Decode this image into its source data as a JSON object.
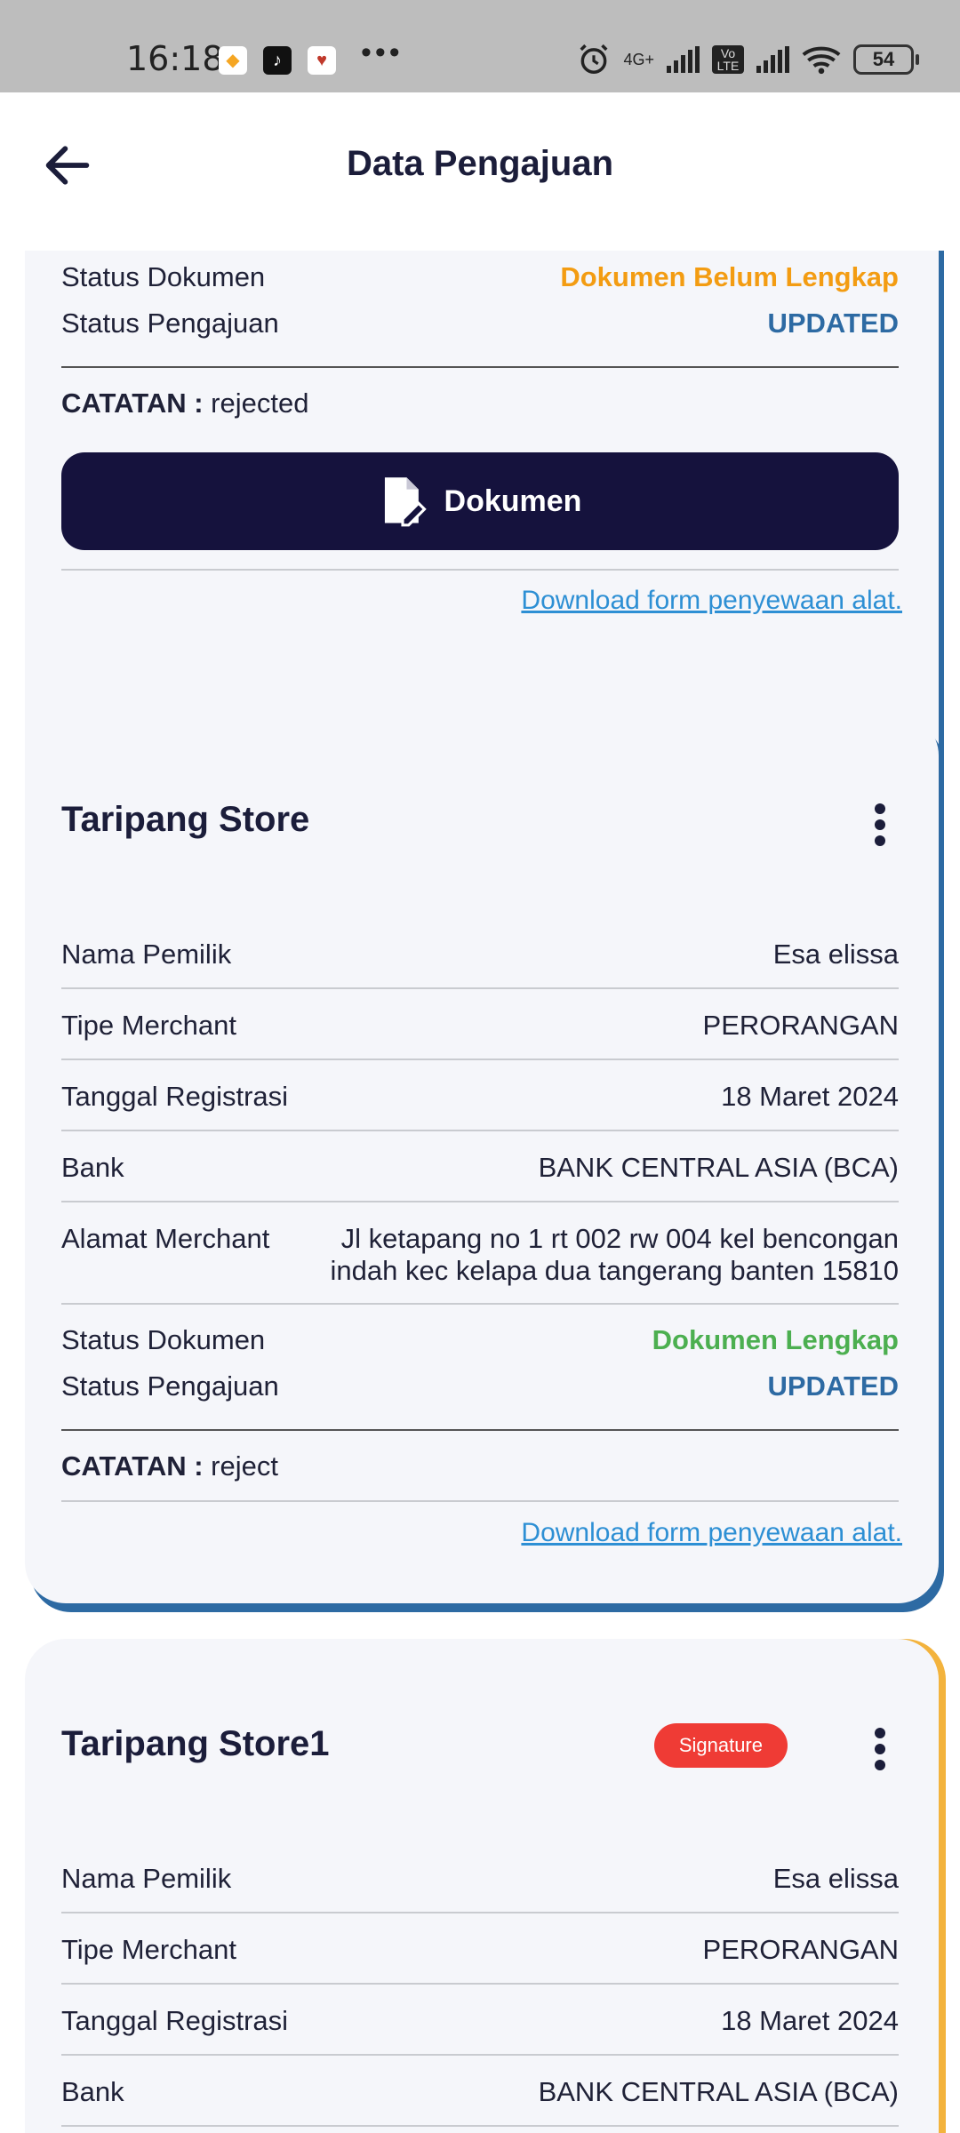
{
  "status_bar": {
    "time": "16:18",
    "network_label": "4G+",
    "volte_label": "Vo LTE",
    "battery": "54"
  },
  "header": {
    "title": "Data Pengajuan"
  },
  "card1": {
    "status_dokumen_label": "Status Dokumen",
    "status_dokumen_value": "Dokumen Belum Lengkap",
    "status_pengajuan_label": "Status Pengajuan",
    "status_pengajuan_value": "UPDATED",
    "catatan_label": "CATATAN :",
    "catatan_value": "rejected",
    "dokumen_button": "Dokumen",
    "download_link": "Download form penyewaan alat."
  },
  "card2": {
    "title": "Taripang Store",
    "nama_pemilik_label": "Nama Pemilik",
    "nama_pemilik_value": "Esa elissa",
    "tipe_merchant_label": "Tipe Merchant",
    "tipe_merchant_value": "PERORANGAN",
    "tanggal_label": "Tanggal Registrasi",
    "tanggal_value": "18 Maret 2024",
    "bank_label": "Bank",
    "bank_value": "BANK CENTRAL ASIA (BCA)",
    "alamat_label": "Alamat Merchant",
    "alamat_line1": "Jl ketapang no 1 rt 002 rw 004 kel bencongan",
    "alamat_line2": "indah kec kelapa dua tangerang banten 15810",
    "status_dokumen_label": "Status Dokumen",
    "status_dokumen_value": "Dokumen Lengkap",
    "status_pengajuan_label": "Status Pengajuan",
    "status_pengajuan_value": "UPDATED",
    "catatan_label": "CATATAN :",
    "catatan_value": "reject",
    "download_link": "Download form penyewaan alat."
  },
  "card3": {
    "title": "Taripang Store1",
    "badge": "Signature",
    "nama_pemilik_label": "Nama Pemilik",
    "nama_pemilik_value": "Esa elissa",
    "tipe_merchant_label": "Tipe Merchant",
    "tipe_merchant_value": "PERORANGAN",
    "tanggal_label": "Tanggal Registrasi",
    "tanggal_value": "18 Maret 2024",
    "bank_label": "Bank",
    "bank_value": "BANK CENTRAL ASIA (BCA)"
  },
  "colors": {
    "primary": "#15123d",
    "accent_blue": "#2d6aa3",
    "accent_orange": "#f3b33d",
    "warning": "#f39c12",
    "success": "#4caf50",
    "badge_red": "#ef3b35",
    "link": "#2d8fd4"
  }
}
